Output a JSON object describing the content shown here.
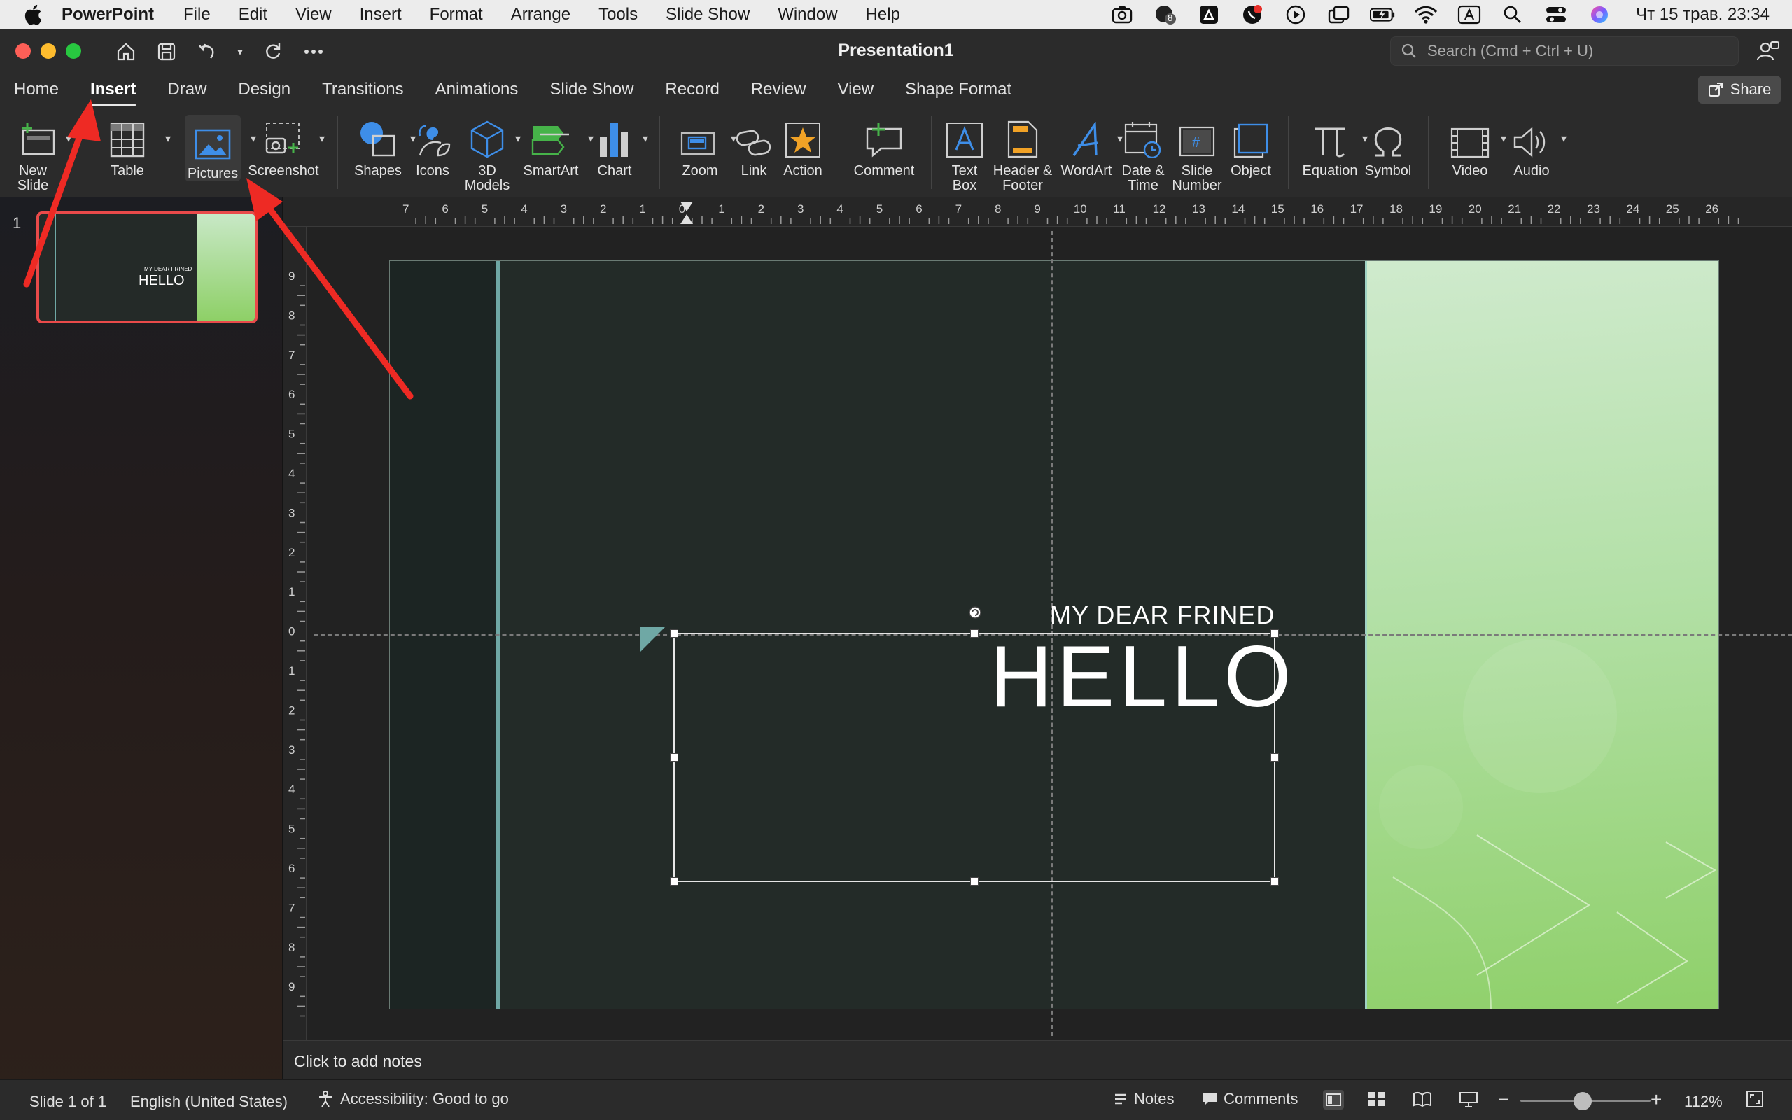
{
  "menubar": {
    "app": "PowerPoint",
    "items": [
      "File",
      "Edit",
      "View",
      "Insert",
      "Format",
      "Arrange",
      "Tools",
      "Slide Show",
      "Window",
      "Help"
    ],
    "clock": "Чт 15 трав. 23:34",
    "badge_count": "8"
  },
  "window": {
    "title": "Presentation1",
    "search_placeholder": "Search (Cmd + Ctrl + U)"
  },
  "tabs": [
    "Home",
    "Insert",
    "Draw",
    "Design",
    "Transitions",
    "Animations",
    "Slide Show",
    "Record",
    "Review",
    "View",
    "Shape Format"
  ],
  "active_tab": "Insert",
  "share_label": "Share",
  "ribbon": {
    "new_slide": "New\nSlide",
    "table": "Table",
    "pictures": "Pictures",
    "screenshot": "Screenshot",
    "shapes": "Shapes",
    "icons": "Icons",
    "models": "3D\nModels",
    "smartart": "SmartArt",
    "chart": "Chart",
    "zoom": "Zoom",
    "link": "Link",
    "action": "Action",
    "comment": "Comment",
    "textbox": "Text\nBox",
    "header_footer": "Header &\nFooter",
    "wordart": "WordArt",
    "datetime": "Date &\nTime",
    "slide_number": "Slide\nNumber",
    "object": "Object",
    "equation": "Equation",
    "symbol": "Symbol",
    "video": "Video",
    "audio": "Audio"
  },
  "slides_panel": {
    "number": "1",
    "thumb_subtitle": "MY DEAR FRINED",
    "thumb_title": "HELLO"
  },
  "ruler": {
    "h_labels": [
      "7",
      "6",
      "5",
      "4",
      "3",
      "2",
      "1",
      "0",
      "1",
      "2",
      "3",
      "4",
      "5",
      "6",
      "7",
      "8",
      "9",
      "10",
      "11",
      "12",
      "13",
      "14",
      "15",
      "16",
      "17",
      "18",
      "19",
      "20",
      "21",
      "22",
      "23",
      "24",
      "25",
      "26"
    ],
    "v_labels": [
      "9",
      "8",
      "7",
      "6",
      "5",
      "4",
      "3",
      "2",
      "1",
      "0",
      "1",
      "2",
      "3",
      "4",
      "5",
      "6",
      "7",
      "8",
      "9"
    ]
  },
  "slide": {
    "subtitle": "MY DEAR FRINED",
    "title": "HELLO"
  },
  "notes_placeholder": "Click to add notes",
  "status": {
    "slide_of": "Slide 1 of 1",
    "language": "English (United States)",
    "accessibility": "Accessibility: Good to go",
    "notes": "Notes",
    "comments": "Comments",
    "zoom": "112%"
  },
  "colors": {
    "accent_red": "#e8302a",
    "slide_dark": "#232b28",
    "slide_teal": "#6fa8a5",
    "slide_green": "#8fd06a"
  }
}
